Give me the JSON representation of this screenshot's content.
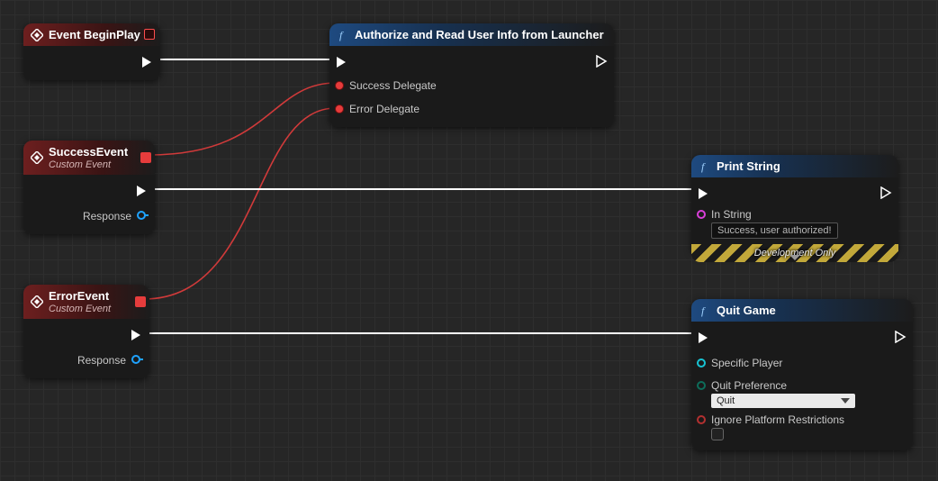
{
  "nodes": {
    "begin_play": {
      "title": "Event BeginPlay"
    },
    "authorize": {
      "title": "Authorize and Read User Info from Launcher",
      "inputs": {
        "success_delegate": "Success Delegate",
        "error_delegate": "Error Delegate"
      }
    },
    "success_event": {
      "title": "SuccessEvent",
      "subtitle": "Custom Event",
      "outputs": {
        "response": "Response"
      }
    },
    "error_event": {
      "title": "ErrorEvent",
      "subtitle": "Custom Event",
      "outputs": {
        "response": "Response"
      }
    },
    "print_string": {
      "title": "Print String",
      "in_string_label": "In String",
      "in_string_value": "Success, user authorized!",
      "dev_only": "Development Only"
    },
    "quit_game": {
      "title": "Quit Game",
      "specific_player": "Specific Player",
      "quit_pref_label": "Quit Preference",
      "quit_pref_value": "Quit",
      "ignore_platform": "Ignore Platform Restrictions"
    }
  }
}
